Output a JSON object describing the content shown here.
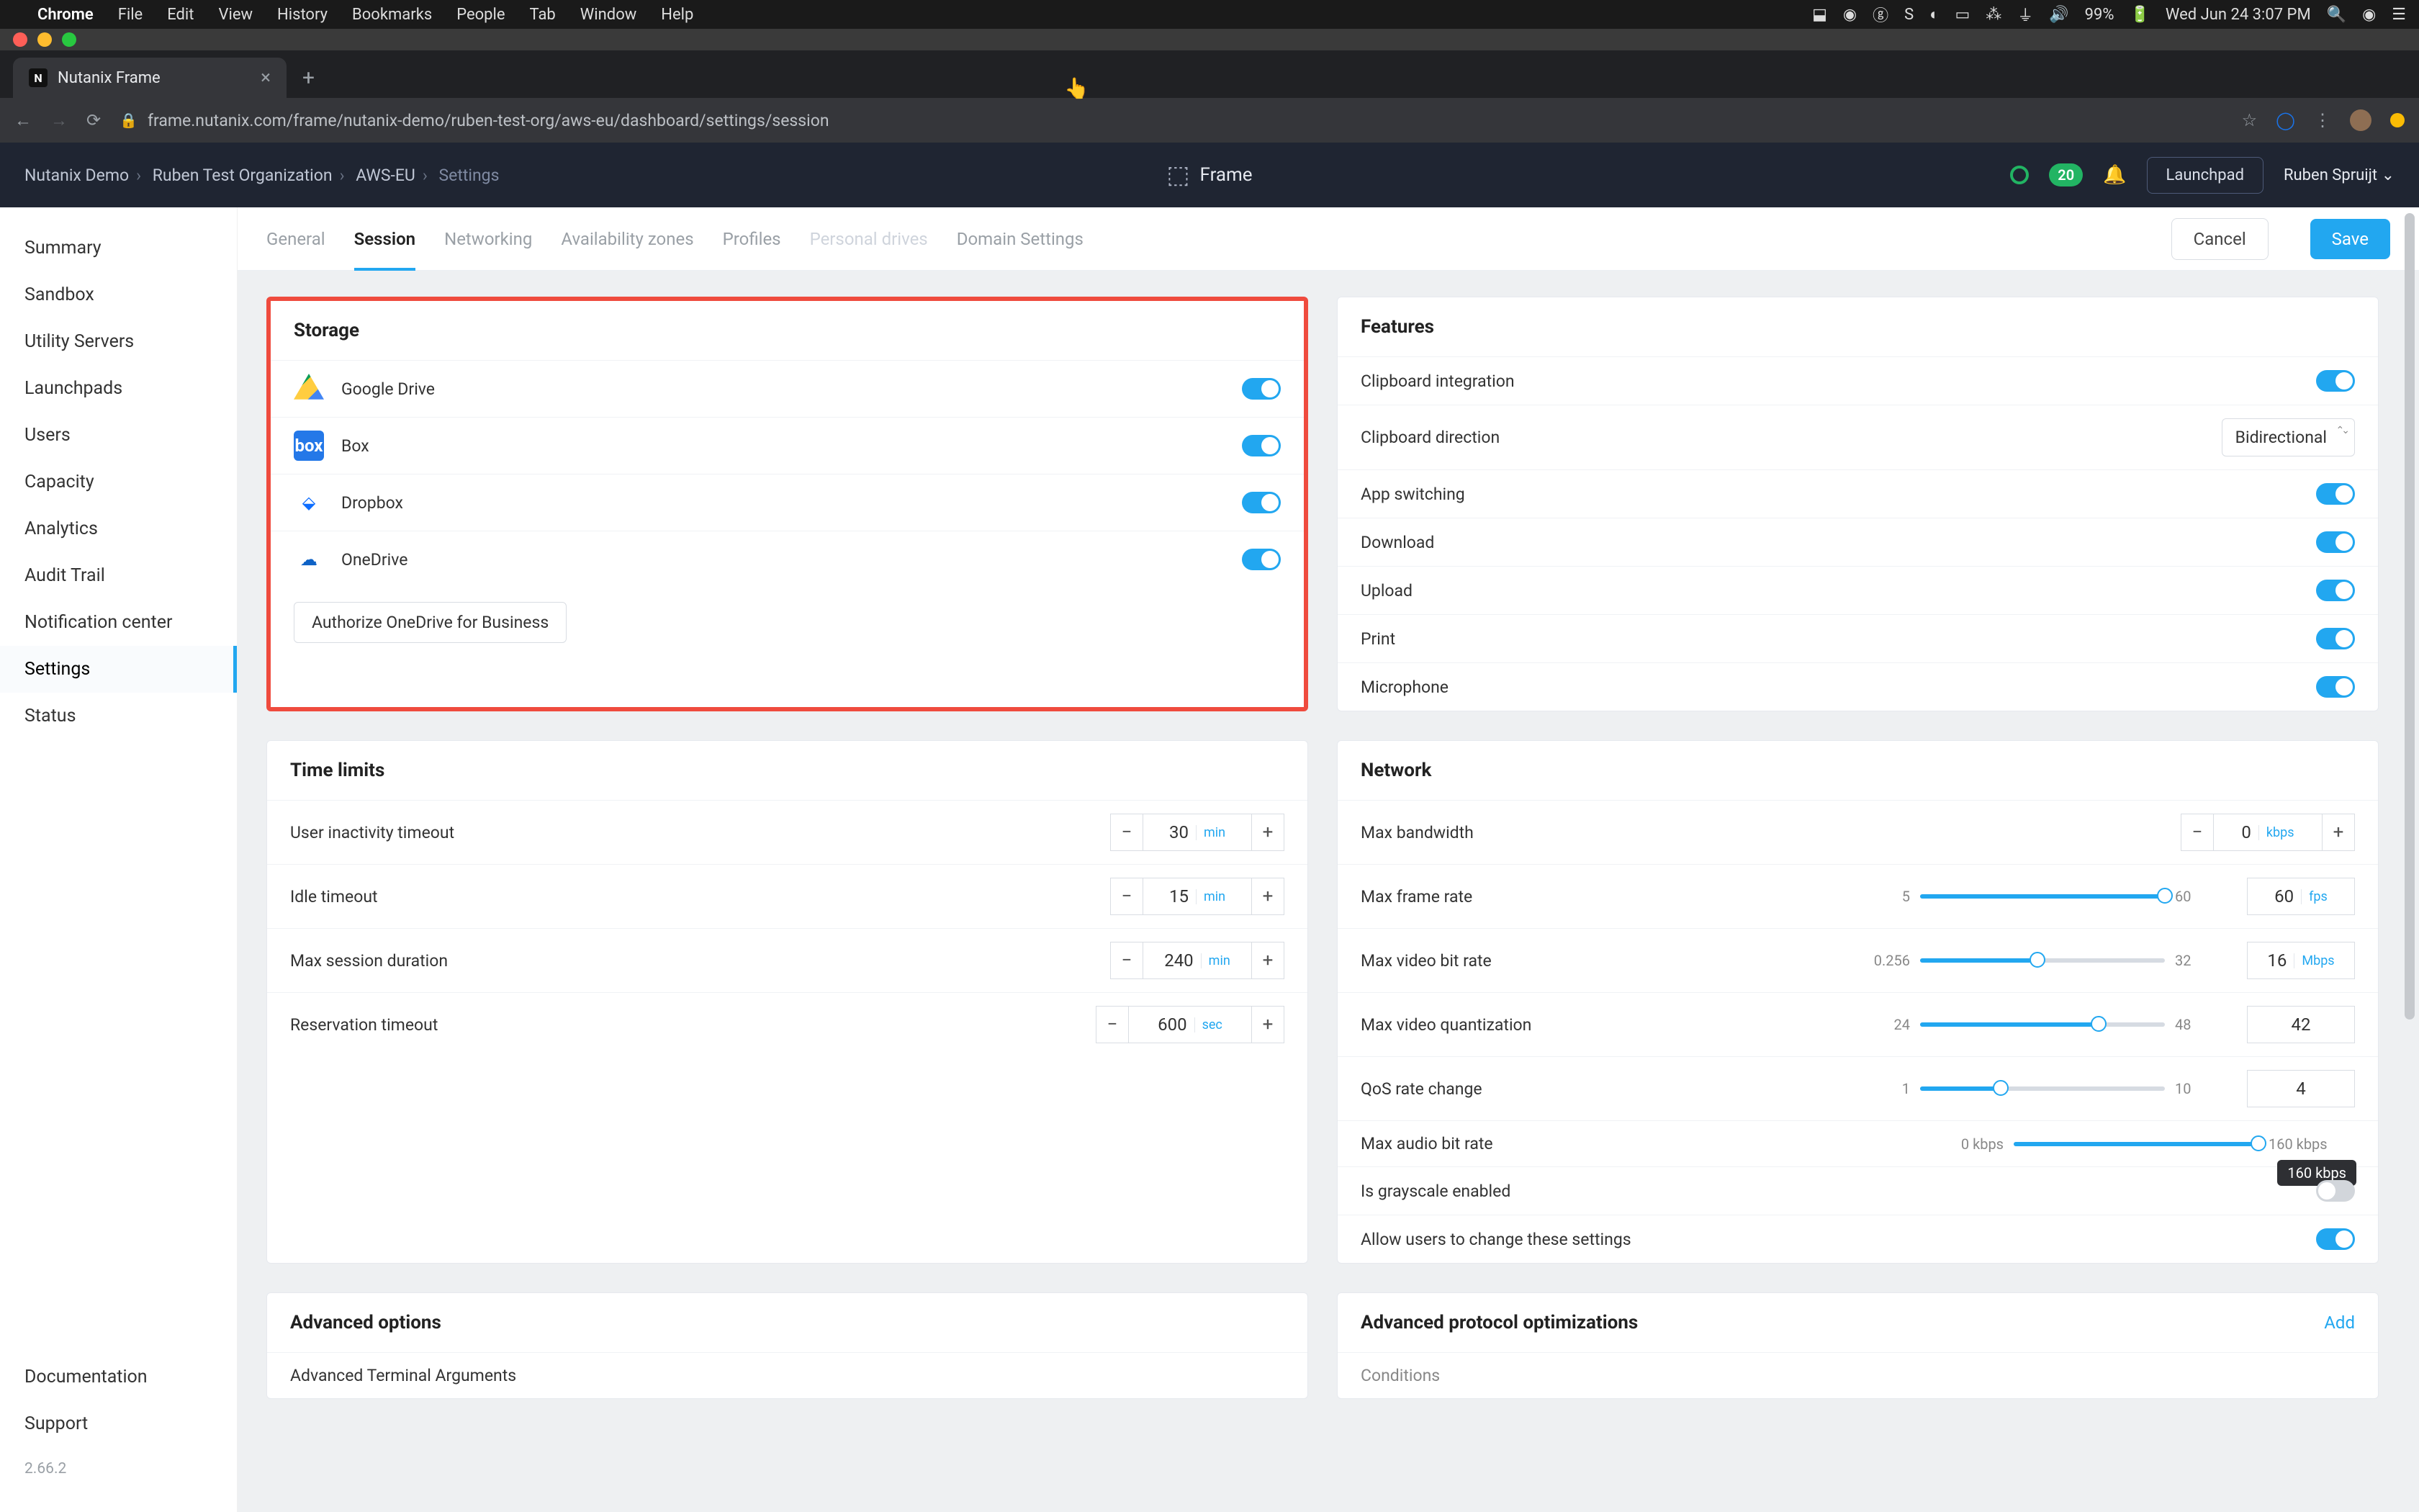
{
  "menubar": {
    "app": "Chrome",
    "items": [
      "File",
      "Edit",
      "View",
      "History",
      "Bookmarks",
      "People",
      "Tab",
      "Window",
      "Help"
    ],
    "battery": "99%",
    "datetime": "Wed Jun 24  3:07 PM"
  },
  "tab": {
    "title": "Nutanix Frame"
  },
  "url": "frame.nutanix.com/frame/nutanix-demo/ruben-test-org/aws-eu/dashboard/settings/session",
  "breadcrumb": [
    "Nutanix Demo",
    "Ruben Test Organization",
    "AWS-EU",
    "Settings"
  ],
  "brand": "Frame",
  "header": {
    "badge": "20",
    "launchpad": "Launchpad",
    "user": "Ruben Spruijt"
  },
  "sidebar": {
    "items": [
      "Summary",
      "Sandbox",
      "Utility Servers",
      "Launchpads",
      "Users",
      "Capacity",
      "Analytics",
      "Audit Trail",
      "Notification center",
      "Settings",
      "Status"
    ],
    "active": "Settings",
    "footer": [
      "Documentation",
      "Support"
    ],
    "version": "2.66.2"
  },
  "subtabs": {
    "items": [
      "General",
      "Session",
      "Networking",
      "Availability zones",
      "Profiles",
      "Personal drives",
      "Domain Settings"
    ],
    "active": "Session",
    "disabled": [
      "Personal drives"
    ],
    "cancel": "Cancel",
    "save": "Save"
  },
  "storage": {
    "title": "Storage",
    "items": [
      {
        "label": "Google Drive",
        "on": true,
        "icon": "gdrive"
      },
      {
        "label": "Box",
        "on": true,
        "icon": "box"
      },
      {
        "label": "Dropbox",
        "on": true,
        "icon": "dropbox"
      },
      {
        "label": "OneDrive",
        "on": true,
        "icon": "onedrive"
      }
    ],
    "authorize": "Authorize OneDrive for Business"
  },
  "features": {
    "title": "Features",
    "clipboard_integration": {
      "label": "Clipboard integration",
      "on": true
    },
    "clipboard_direction": {
      "label": "Clipboard direction",
      "value": "Bidirectional"
    },
    "app_switching": {
      "label": "App switching",
      "on": true
    },
    "download": {
      "label": "Download",
      "on": true
    },
    "upload": {
      "label": "Upload",
      "on": true
    },
    "print": {
      "label": "Print",
      "on": true
    },
    "microphone": {
      "label": "Microphone",
      "on": true
    }
  },
  "timelimits": {
    "title": "Time limits",
    "user_inactivity": {
      "label": "User inactivity timeout",
      "value": "30",
      "unit": "min"
    },
    "idle_timeout": {
      "label": "Idle timeout",
      "value": "15",
      "unit": "min"
    },
    "max_session": {
      "label": "Max session duration",
      "value": "240",
      "unit": "min"
    },
    "reservation": {
      "label": "Reservation timeout",
      "value": "600",
      "unit": "sec"
    }
  },
  "network": {
    "title": "Network",
    "max_bandwidth": {
      "label": "Max bandwidth",
      "value": "0",
      "unit": "kbps"
    },
    "max_frame_rate": {
      "label": "Max frame rate",
      "min": "5",
      "max": "60",
      "value": "60",
      "unit": "fps",
      "pct": 100
    },
    "max_video_bit_rate": {
      "label": "Max video bit rate",
      "min": "0.256",
      "max": "32",
      "value": "16",
      "unit": "Mbps",
      "pct": 48
    },
    "max_video_quant": {
      "label": "Max video quantization",
      "min": "24",
      "max": "48",
      "value": "42",
      "pct": 73
    },
    "qos_rate": {
      "label": "QoS rate change",
      "min": "1",
      "max": "10",
      "value": "4",
      "pct": 33
    },
    "max_audio_bit": {
      "label": "Max audio bit rate",
      "min": "0 kbps",
      "max": "160 kbps",
      "pct": 100,
      "tooltip": "160 kbps"
    },
    "grayscale": {
      "label": "Is grayscale enabled",
      "on": false
    },
    "allow_users": {
      "label": "Allow users to change these settings",
      "on": true
    }
  },
  "advanced_options": {
    "title": "Advanced options",
    "terminal": "Advanced Terminal Arguments"
  },
  "advanced_protocol": {
    "title": "Advanced protocol optimizations",
    "add": "Add",
    "conditions": "Conditions"
  }
}
